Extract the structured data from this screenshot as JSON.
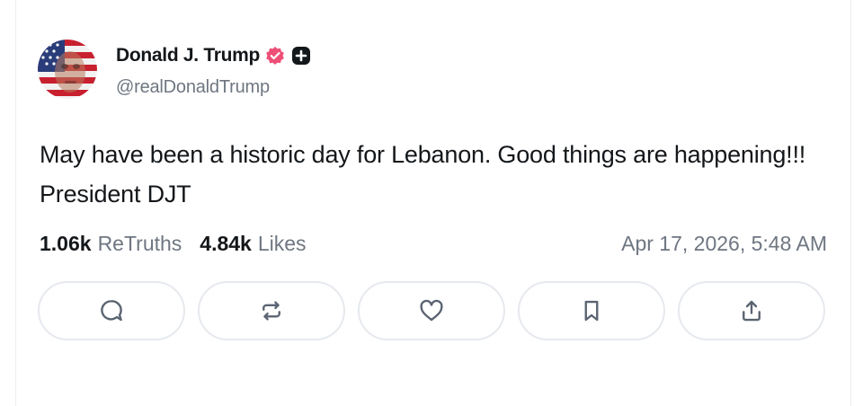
{
  "post": {
    "author": {
      "display_name": "Donald J. Trump",
      "handle": "@realDonaldTrump",
      "verified": true,
      "colors": {
        "verified_badge": "#ee4f77",
        "plus_badge": "#14171a"
      }
    },
    "text": "May have been a historic day for Lebanon. Good things are happening!!! President DJT",
    "stats": {
      "retruths_count": "1.06k",
      "retruths_label": "ReTruths",
      "likes_count": "4.84k",
      "likes_label": "Likes"
    },
    "timestamp": "Apr 17, 2026, 5:48 AM",
    "actions": [
      {
        "name": "reply",
        "icon": "comment-icon"
      },
      {
        "name": "retruth",
        "icon": "repost-icon"
      },
      {
        "name": "like",
        "icon": "heart-icon"
      },
      {
        "name": "bookmark",
        "icon": "bookmark-icon"
      },
      {
        "name": "share",
        "icon": "share-icon"
      }
    ]
  }
}
